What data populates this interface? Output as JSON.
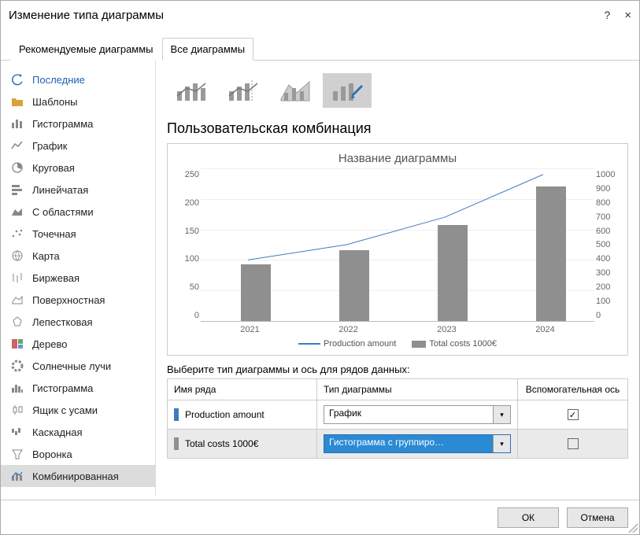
{
  "window": {
    "title": "Изменение типа диаграммы",
    "help": "?",
    "close": "×"
  },
  "tabs": {
    "recommended": "Рекомендуемые диаграммы",
    "all": "Все диаграммы"
  },
  "sidebar": {
    "items": [
      {
        "label": "Последние"
      },
      {
        "label": "Шаблоны"
      },
      {
        "label": "Гистограмма"
      },
      {
        "label": "График"
      },
      {
        "label": "Круговая"
      },
      {
        "label": "Линейчатая"
      },
      {
        "label": "С областями"
      },
      {
        "label": "Точечная"
      },
      {
        "label": "Карта"
      },
      {
        "label": "Биржевая"
      },
      {
        "label": "Поверхностная"
      },
      {
        "label": "Лепестковая"
      },
      {
        "label": "Дерево"
      },
      {
        "label": "Солнечные лучи"
      },
      {
        "label": "Гистограмма"
      },
      {
        "label": "Ящик с усами"
      },
      {
        "label": "Каскадная"
      },
      {
        "label": "Воронка"
      },
      {
        "label": "Комбинированная"
      }
    ]
  },
  "section_title": "Пользовательская комбинация",
  "chart_data": {
    "type": "combo",
    "title": "Название диаграммы",
    "categories": [
      "2021",
      "2022",
      "2023",
      "2024"
    ],
    "series": [
      {
        "name": "Production amount",
        "type": "line",
        "axis": "primary",
        "values": [
          100,
          125,
          170,
          240
        ]
      },
      {
        "name": "Total costs 1000€",
        "type": "bar",
        "axis": "secondary",
        "values": [
          400,
          500,
          675,
          950
        ]
      }
    ],
    "y_primary": {
      "min": 0,
      "max": 250,
      "ticks": [
        0,
        50,
        100,
        150,
        200,
        250
      ]
    },
    "y_secondary": {
      "min": 0,
      "max": 1000,
      "ticks": [
        0,
        100,
        200,
        300,
        400,
        500,
        600,
        700,
        800,
        900,
        1000
      ]
    },
    "legend": {
      "s1": "Production amount",
      "s2": "Total costs 1000€"
    }
  },
  "series_section": {
    "intro": "Выберите тип диаграммы и ось для рядов данных:",
    "col_name": "Имя ряда",
    "col_type": "Тип диаграммы",
    "col_axis": "Вспомогательная ось",
    "rows": [
      {
        "name": "Production amount",
        "type": "График",
        "secondary": true
      },
      {
        "name": "Total costs 1000€",
        "type": "Гистограмма с группиро…",
        "secondary": false
      }
    ]
  },
  "footer": {
    "ok": "ОК",
    "cancel": "Отмена"
  }
}
